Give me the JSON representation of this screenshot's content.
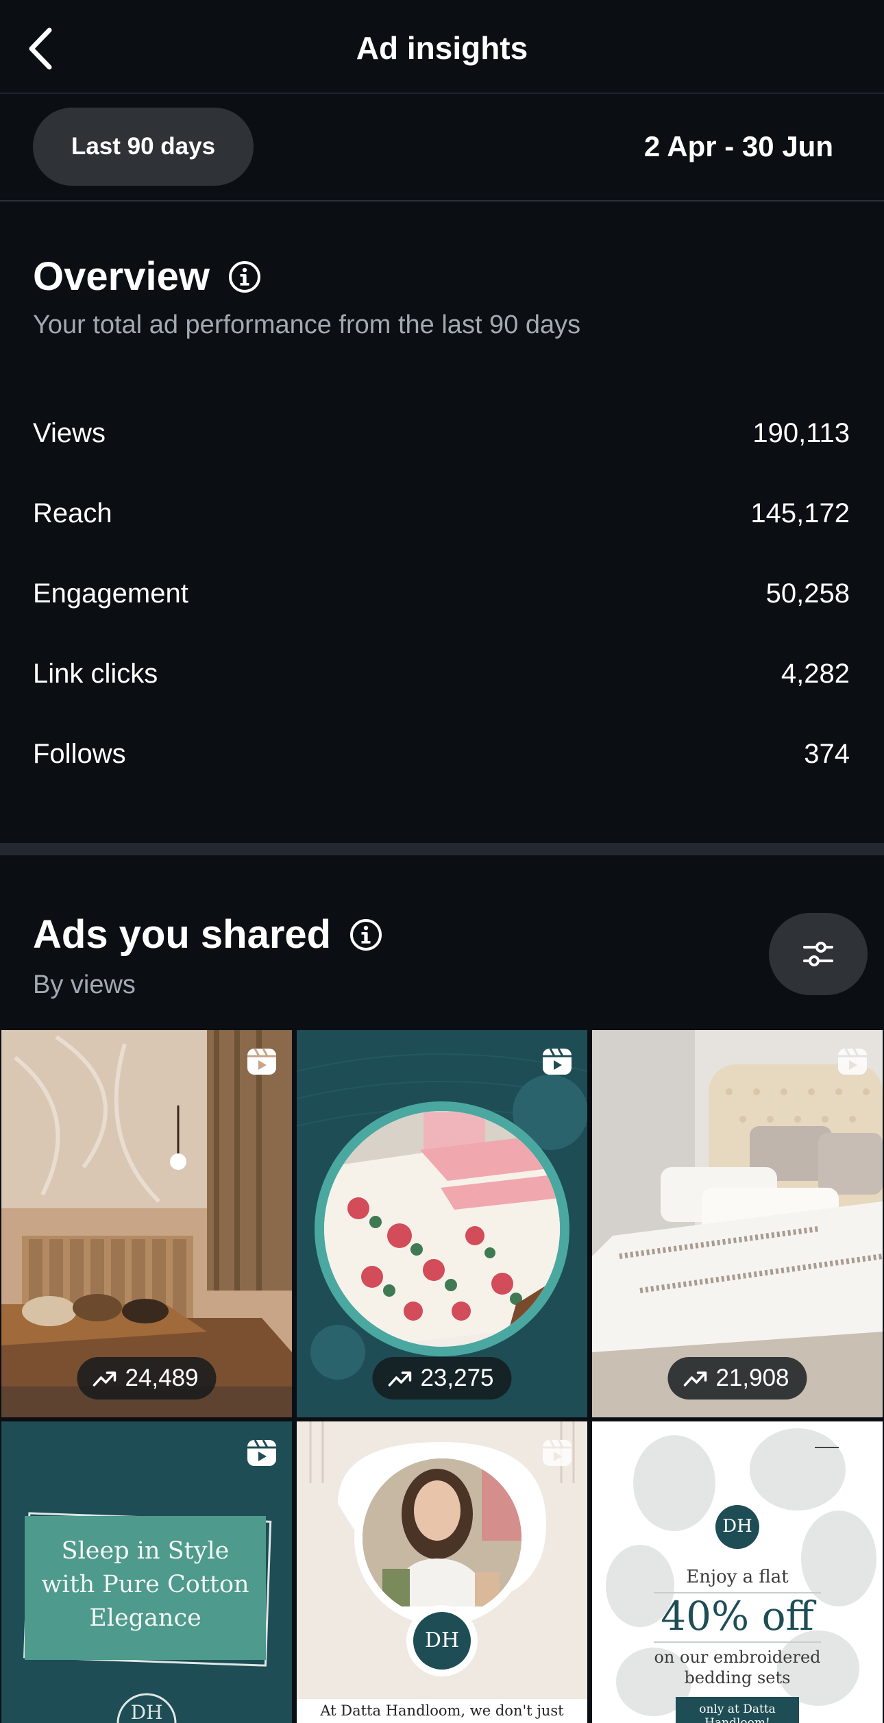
{
  "header": {
    "title": "Ad insights",
    "back_icon": "chevron-left-icon"
  },
  "range": {
    "pill_label": "Last 90 days",
    "dates": "2 Apr - 30 Jun"
  },
  "overview": {
    "title": "Overview",
    "subtitle": "Your total ad performance from the last 90 days",
    "metrics": [
      {
        "label": "Views",
        "value": "190,113"
      },
      {
        "label": "Reach",
        "value": "145,172"
      },
      {
        "label": "Engagement",
        "value": "50,258"
      },
      {
        "label": "Link clicks",
        "value": "4,282"
      },
      {
        "label": "Follows",
        "value": "374"
      }
    ]
  },
  "ads": {
    "title": "Ads you shared",
    "subtitle": "By views",
    "filter_icon": "sliders-icon",
    "tiles": [
      {
        "views": "24,489"
      },
      {
        "views": "23,275"
      },
      {
        "views": "21,908"
      },
      {
        "text_lines": [
          "Sleep in Style",
          "with Pure Cotton",
          "Elegance"
        ],
        "logo": "DH"
      },
      {
        "logo": "DH",
        "caption": "At Datta Handloom, we don't just"
      },
      {
        "logo": "DH",
        "line1": "Enjoy a flat",
        "headline": "40% off",
        "line2": "on our embroidered",
        "line3": "bedding sets",
        "banner": "only at Datta Handloom!"
      }
    ]
  },
  "colors": {
    "background": "#0b0f14",
    "pill": "#2f3338",
    "muted_text": "#a3a9b1",
    "teal": "#1e4d55"
  }
}
